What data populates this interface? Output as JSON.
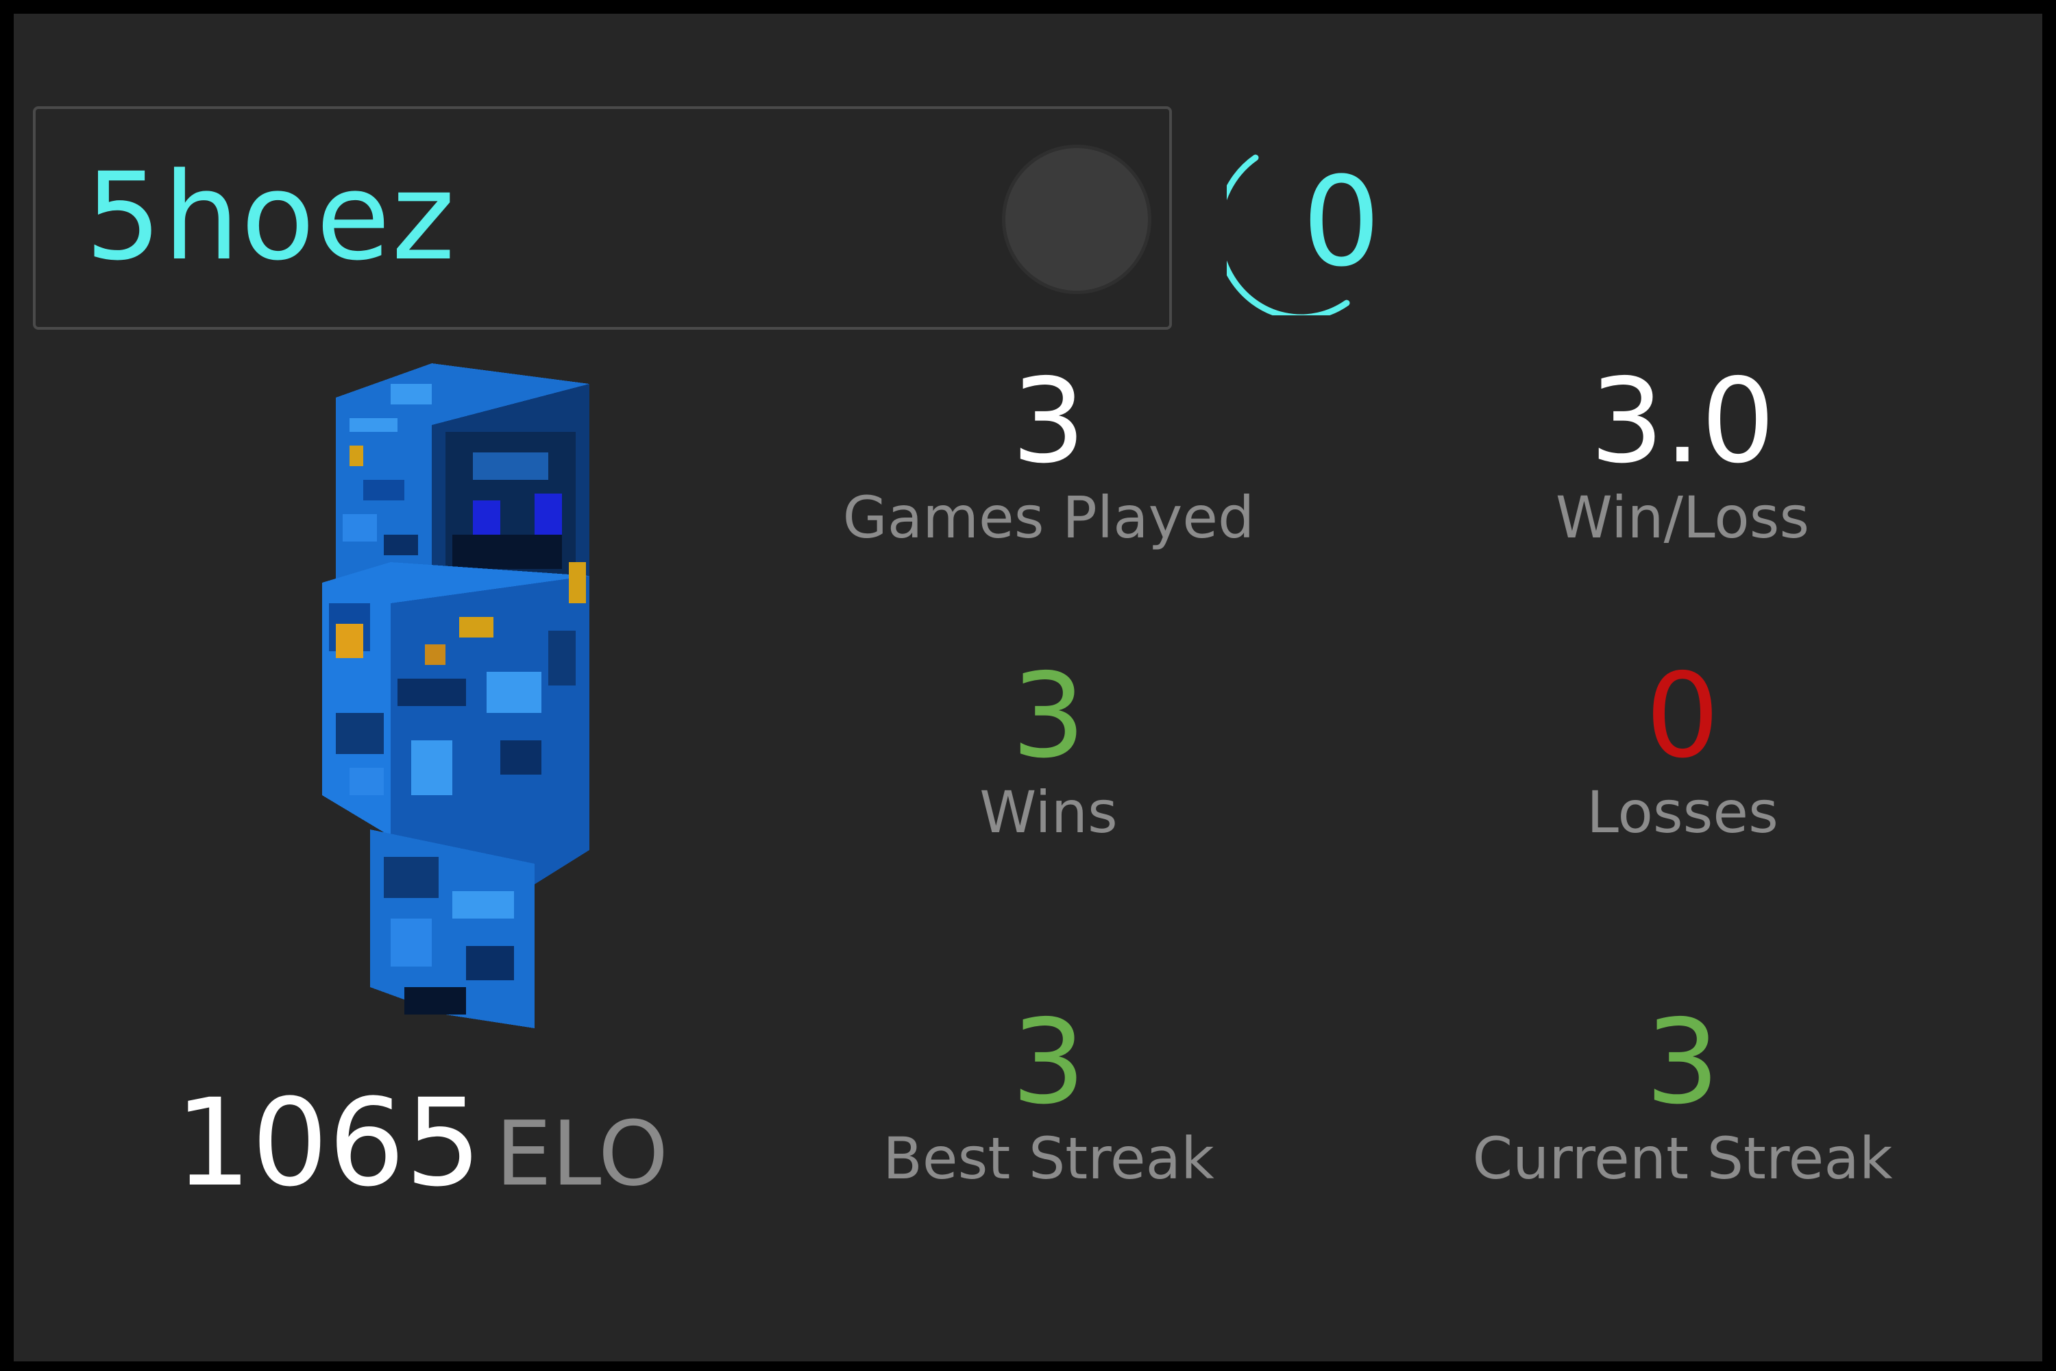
{
  "player": {
    "name": "5hoez",
    "level": "0",
    "elo_value": "1065",
    "elo_unit": "ELO"
  },
  "stats": {
    "games_played": {
      "value": "3",
      "label": "Games Played"
    },
    "win_loss": {
      "value": "3.0",
      "label": "Win/Loss"
    },
    "wins": {
      "value": "3",
      "label": "Wins"
    },
    "losses": {
      "value": "0",
      "label": "Losses"
    },
    "best_streak": {
      "value": "3",
      "label": "Best Streak"
    },
    "current_streak": {
      "value": "3",
      "label": "Current Streak"
    }
  },
  "colors": {
    "background": "#262626",
    "accent_cyan": "#5cf0ec",
    "positive_green": "#6ab04c",
    "negative_red": "#c41010",
    "label_gray": "#8c8c8c"
  },
  "icons": {
    "status": "status-dot-icon",
    "level_ring": "level-ring-icon",
    "skin": "player-skin-image"
  }
}
